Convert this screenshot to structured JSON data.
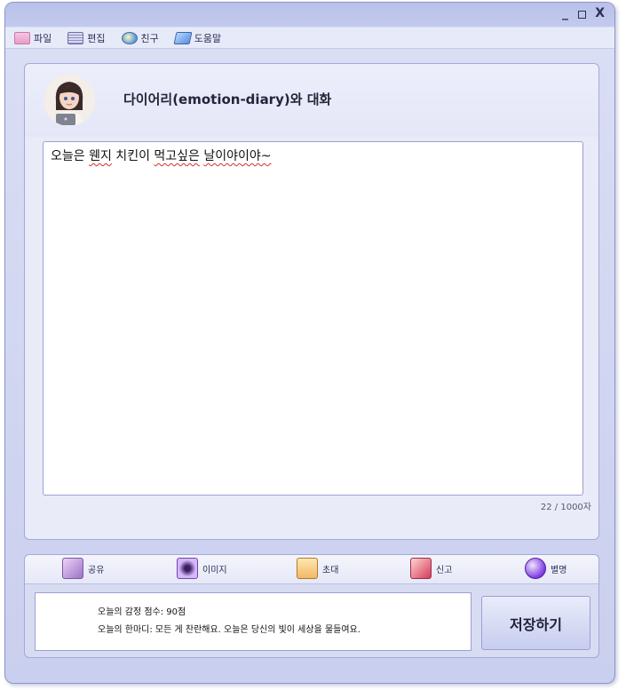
{
  "window": {
    "controls": {
      "minimize": "_",
      "close": "X"
    }
  },
  "menubar": {
    "items": [
      {
        "label": "파일",
        "icon": "folder-icon"
      },
      {
        "label": "편집",
        "icon": "edit-icon"
      },
      {
        "label": "친구",
        "icon": "friend-icon"
      },
      {
        "label": "도움말",
        "icon": "help-icon"
      }
    ]
  },
  "chat": {
    "title": "다이어리(emotion-diary)와 대화",
    "avatar": "avatar-girl-with-laptop",
    "editor": {
      "text_prefix": "오늘은 ",
      "text_word1": "웬지",
      "text_mid": " 치킨이 ",
      "text_word2": "먹고싶은",
      "text_space": " ",
      "text_word3": "날이야이야~",
      "text_full": "오늘은 웬지 치킨이 먹고싶은 날이야이야~"
    },
    "counter": "22 / 1000자"
  },
  "actions": [
    {
      "label": "공유",
      "icon": "share-icon"
    },
    {
      "label": "이미지",
      "icon": "image-icon"
    },
    {
      "label": "초대",
      "icon": "invite-icon"
    },
    {
      "label": "신고",
      "icon": "report-icon"
    },
    {
      "label": "별명",
      "icon": "nickname-icon"
    }
  ],
  "summary": {
    "score_line": "오늘의 감정 점수: 90점",
    "comment_line": "오늘의 한마디: 모든 게 찬란해요. 오늘은 당신의 빛이 세상을 물들여요."
  },
  "save_button": {
    "label": "저장하기"
  },
  "colors": {
    "window_bg": "#d0d5f1",
    "panel_border": "#a3aad6",
    "accent": "#8d96c8"
  }
}
